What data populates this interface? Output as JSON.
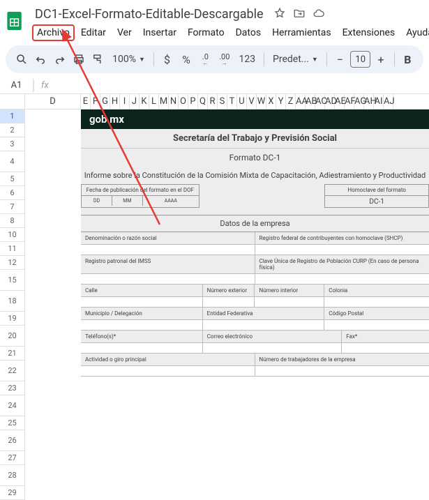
{
  "header": {
    "title": "DC1-Excel-Formato-Editable-Descargable",
    "icons": {
      "star": "star-icon",
      "folder": "move-icon",
      "cloud": "cloud-icon"
    }
  },
  "menu": [
    "Archivo",
    "Editar",
    "Ver",
    "Insertar",
    "Formato",
    "Datos",
    "Herramientas",
    "Extensiones",
    "Ayuda"
  ],
  "toolbar": {
    "zoom": "100%",
    "currency": "$",
    "percent": "%",
    "dec_dec": ".0",
    "dec_inc": ".00",
    "num_fmt": "123",
    "font": "Predet...",
    "minus": "−",
    "font_size": "10",
    "plus": "+",
    "bold": "B"
  },
  "name_box": "A1",
  "fx_label": "fx",
  "columns_first": "D",
  "columns_narrow": [
    "E",
    "F",
    "G",
    "H",
    "I",
    "J",
    "K",
    "L",
    "M",
    "N",
    "O",
    "P",
    "Q",
    "R",
    "S",
    "T",
    "U",
    "V",
    "W",
    "X",
    "Y",
    "Z",
    "AA",
    "AB",
    "AC",
    "AD",
    "AE",
    "AF",
    "AG",
    "AH",
    "AI",
    "AJ"
  ],
  "rows": [
    "1",
    "2",
    "3",
    "4",
    "5",
    "6",
    "7",
    "8",
    "10",
    "11",
    "12",
    "15",
    "18",
    "19",
    "20",
    "21",
    "22",
    "23",
    "24",
    "25",
    "26",
    "27",
    "28",
    "29"
  ],
  "tall_rows": [
    "4",
    "15",
    "18",
    "20",
    "22",
    "24",
    "26",
    "28"
  ],
  "content": {
    "gobmx_a": "gob",
    "gobmx_b": "mx",
    "secretaria": "Secretaría del Trabajo y Previsión Social",
    "formato": "Formato DC-1",
    "informe": "Informe sobre la Constitución de la Comisión Mixta de Capacitación, Adiestramiento y Productividad",
    "fecha_pub_label": "Fecha de publicación del formato en el DOF",
    "fecha_dd": "DD",
    "fecha_mm": "MM",
    "fecha_aaaa": "AAAA",
    "homoclave_label": "Homoclave del formato",
    "homoclave_val": "DC-1",
    "datos_empresa": "Datos de la empresa",
    "denominacion": "Denominación o razón social",
    "rfc": "Registro federal de contribuyentes con homoclave (SHCP)",
    "registro_imss": "Registro patronal del IMSS",
    "curp": "Clave Única de Registro de Población CURP (En caso de persona física)",
    "calle": "Calle",
    "num_ext": "Número exterior",
    "num_int": "Número interior",
    "colonia": "Colonia",
    "municipio": "Municipio / Delegación",
    "entidad": "Entidad Federativa",
    "cp": "Código Postal",
    "telefono": "Teléfono(s)*",
    "correo": "Correo electrónico",
    "fax": "Fax*",
    "actividad": "Actividad o giro principal",
    "num_trabajadores": "Número de trabajadores de la empresa"
  }
}
